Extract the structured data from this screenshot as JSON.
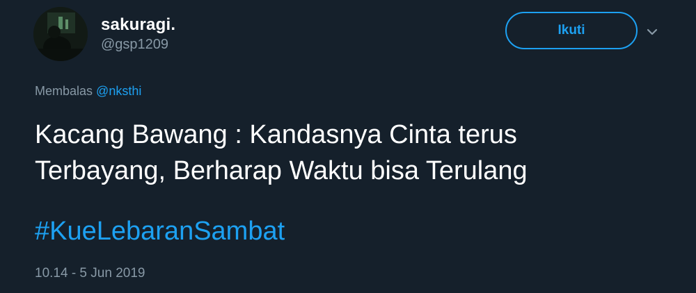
{
  "author": {
    "display_name": "sakuragi.",
    "handle": "@gsp1209",
    "avatar_icon": "profile-photo"
  },
  "actions": {
    "follow_label": "Ikuti",
    "more_icon": "chevron-down-icon"
  },
  "reply": {
    "prefix": "Membalas",
    "mention": "@nksthi"
  },
  "tweet": {
    "line1": "Kacang Bawang : Kandasnya Cinta terus",
    "line2": "Terbayang, Berharap Waktu bisa Terulang",
    "hashtag": "#KueLebaranSambat",
    "timestamp": "10.14 - 5 Jun 2019"
  },
  "colors": {
    "background": "#15202b",
    "accent": "#1da1f2",
    "secondary_text": "#8899a6",
    "primary_text": "#ffffff"
  }
}
